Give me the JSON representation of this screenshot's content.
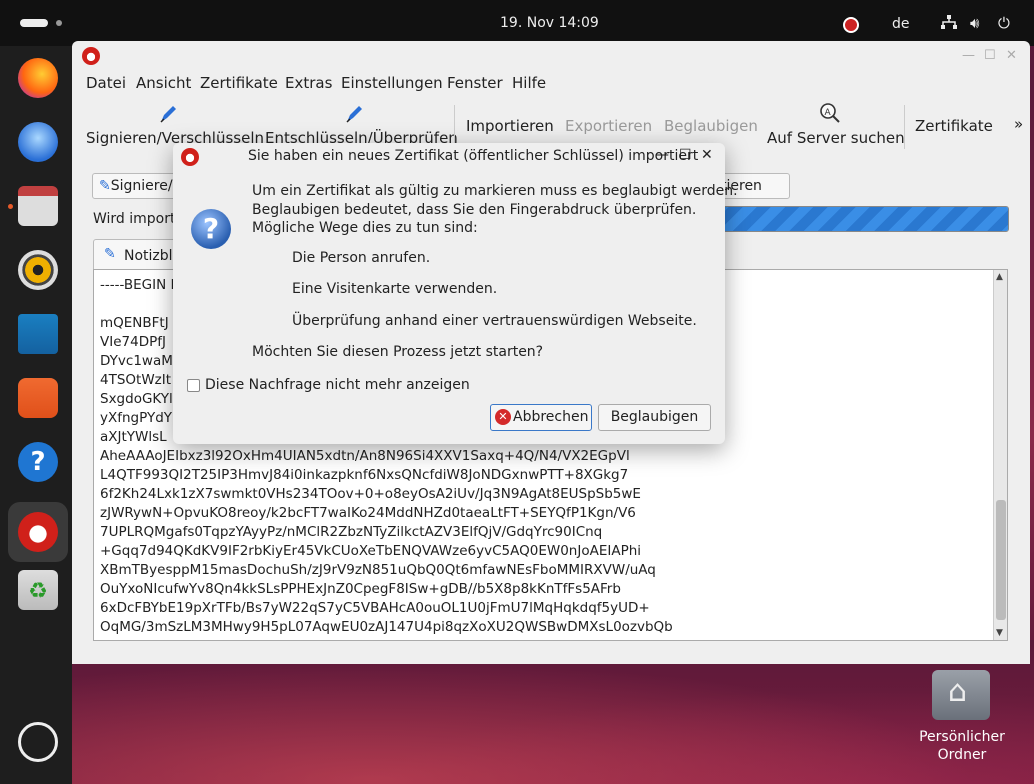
{
  "topbar": {
    "clock": "19. Nov  14:09",
    "keyboard_layout": "de"
  },
  "desktop": {
    "home_folder_label": "Persönlicher Ordner"
  },
  "window": {
    "menu": [
      "Datei",
      "Ansicht",
      "Zertifikate",
      "Extras",
      "Einstellungen",
      "Fenster",
      "Hilfe"
    ],
    "toolbar": {
      "sign_encrypt": "Signieren/Verschlüsseln",
      "decrypt_verify": "Entschlüsseln/Überprüfen",
      "import": "Importieren",
      "export": "Exportieren",
      "certify": "Beglaubigen",
      "server_search": "Auf Server suchen",
      "certificates": "Zertifikate",
      "overflow": "»"
    },
    "action_row": {
      "sign_button": "Signiere/",
      "import_button": "tieren"
    },
    "status_label": "Wird import",
    "progress_percent": 100,
    "tab_label": "Notizbl",
    "editor_lines": [
      "-----BEGIN P",
      "",
      "mQENBFtJ",
      "VIe74DPfJ",
      "DYvc1waM",
      "4TSOtWzIt",
      "SxgdoGKYl",
      "yXfngPYdY",
      "aXJtYWlsL",
      "AheAAAoJEIbxz3l92OxHm4UIAN5xdtn/An8N96Si4XXV1Saxq+4Q/N4/VX2EGpVl",
      "L4QTF993QI2T25IP3HmvJ84i0inkazpknf6NxsQNcfdiW8JoNDGxnwPTT+8XGkg7",
      "6f2Kh24Lxk1zX7swmkt0VHs234TOov+0+o8eyOsA2iUv/Jq3N9AgAt8EUSpSb5wE",
      "zJWRywN+OpvuKO8reoy/k2bcFT7waIKo24MddNHZd0taeaLtFT+SEYQfP1Kgn/V6",
      "7UPLRQMgafs0TqpzYAyyPz/nMClR2ZbzNTyZilkctAZV3ElfQjV/GdqYrc90ICnq",
      "+Gqq7d94QKdKV9IF2rbKiyEr45VkCUoXeTbENQVAWze6yvC5AQ0EW0nJoAEIAPhi",
      "XBmTByesppM15masDochuSh/zJ9rV9zN851uQbQ0Qt6mfawNEsFboMMIRXVW/uAq",
      "OuYxoNIcufwYv8Qn4kkSLsPPHExJnZ0CpegF8ISw+gDB//b5X8p8kKnTfFs5AFrb",
      "6xDcFBYbE19pXrTFb/Bs7yW22qS7yC5VBAHcA0ouOL1U0jFmU7lMqHqkdqf5yUD+",
      "OqMG/3mSzLM3MHwy9H5pL07AqwEU0zAJ147U4pi8qzXoXU2QWSBwDMXsL0ozvbQb"
    ]
  },
  "dialog": {
    "title": "Sie haben ein neues Zertifikat (öffentlicher Schlüssel) importiert",
    "intro_line1": "Um ein Zertifikat als gültig zu markieren muss es beglaubigt werden.",
    "intro_line2": "Beglaubigen bedeutet, dass Sie den Fingerabdruck überprüfen.",
    "intro_line3": "Mögliche Wege dies zu tun sind:",
    "option1": "Die Person anrufen.",
    "option2": "Eine Visitenkarte verwenden.",
    "option3": "Überprüfung anhand einer vertrauenswürdigen Webseite.",
    "question": "Möchten Sie diesen Prozess jetzt starten?",
    "checkbox_label": "Diese Nachfrage nicht mehr anzeigen",
    "checkbox_checked": false,
    "cancel_button": "Abbrechen",
    "certify_button": "Beglaubigen"
  }
}
